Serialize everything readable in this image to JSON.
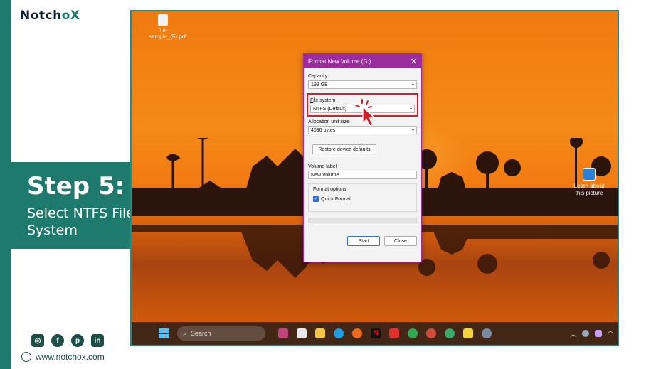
{
  "brand": {
    "logo_main": "Notch",
    "logo_o": "o",
    "logo_x": "X"
  },
  "step": {
    "title": "Step 5:",
    "subtitle": "Select NTFS File System"
  },
  "footer": {
    "website": "www.notchox.com",
    "socials": [
      "instagram-icon",
      "facebook-icon",
      "pinterest-icon",
      "linkedin-icon"
    ]
  },
  "desktop": {
    "learn_label": "Learn about this picture",
    "file_label": "file-sample_(5).pdf"
  },
  "dialog": {
    "title": "Format New Volume (G:)",
    "close_glyph": "✕",
    "capacity_label": "Capacity:",
    "capacity_value": "199 GB",
    "fs_label_first": "F",
    "fs_label_rest": "ile system",
    "fs_value": "NTFS (Default)",
    "alloc_label_first": "A",
    "alloc_label_rest": "llocation unit size",
    "alloc_value": "4096 bytes",
    "restore_label": "Restore device defaults",
    "volume_label_title": "Volume label",
    "volume_label_value": "New Volume",
    "format_options_title": "Format options",
    "quick_format_label": "Quick Format",
    "start_label": "Start",
    "close_label": "Close"
  },
  "taskbar": {
    "search_placeholder": "Search"
  },
  "colors": {
    "brand_teal": "#1f7a6e",
    "dialog_accent": "#9b2c9e",
    "highlight_red": "#d2202a"
  }
}
